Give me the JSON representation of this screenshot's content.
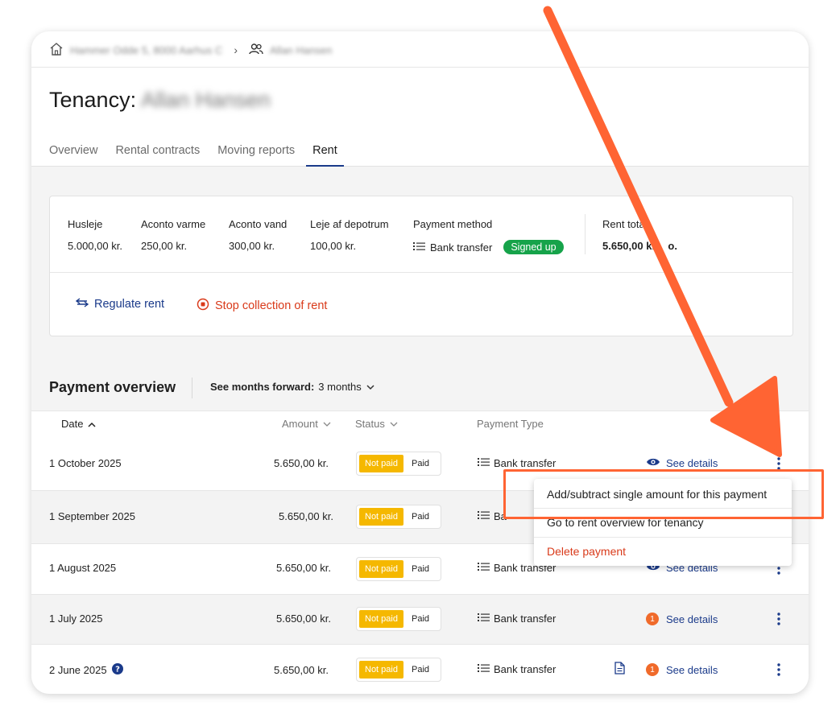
{
  "breadcrumb": {
    "property": "Hammer Odde 5, 8000 Aarhus C",
    "tenant": "Allan Hansen"
  },
  "page": {
    "title_prefix": "Tenancy:",
    "tenant_name": "Allan Hansen"
  },
  "tabs": [
    {
      "label": "Overview",
      "active": false
    },
    {
      "label": "Rental contracts",
      "active": false
    },
    {
      "label": "Moving reports",
      "active": false
    },
    {
      "label": "Rent",
      "active": true
    }
  ],
  "rent": {
    "items": [
      {
        "label": "Husleje",
        "value": "5.000,00 kr."
      },
      {
        "label": "Aconto varme",
        "value": "250,00 kr."
      },
      {
        "label": "Aconto vand",
        "value": "300,00 kr."
      },
      {
        "label": "Leje af depotrum",
        "value": "100,00 kr."
      }
    ],
    "payment_method_label": "Payment method",
    "payment_method_value": "Bank transfer",
    "signed_up_badge": "Signed up",
    "total_label": "Rent total",
    "total_value": "5.650,00 kr. ",
    "total_suffix": "o.",
    "regulate_label": "Regulate rent",
    "stop_label": "Stop collection of rent"
  },
  "payment_overview": {
    "title": "Payment overview",
    "months_label": "See months forward:",
    "months_value": "3 months",
    "columns": {
      "date": "Date",
      "amount": "Amount",
      "status": "Status",
      "payment_type": "Payment Type"
    },
    "rows": [
      {
        "date": "1 October 2025",
        "amount": "5.650,00 kr.",
        "status_not_paid": "Not paid",
        "status_paid": "Paid",
        "payment_type": "Bank transfer",
        "details": "See details"
      },
      {
        "date": "1 September 2025",
        "amount": "5.650,00 kr.",
        "status_not_paid": "Not paid",
        "status_paid": "Paid",
        "payment_type": "Ba",
        "details": ""
      },
      {
        "date": "1 August 2025",
        "amount": "5.650,00 kr.",
        "status_not_paid": "Not paid",
        "status_paid": "Paid",
        "payment_type": "Bank transfer",
        "details": "See details"
      },
      {
        "date": "1 July 2025",
        "amount": "5.650,00 kr.",
        "status_not_paid": "Not paid",
        "status_paid": "Paid",
        "payment_type": "Bank transfer",
        "details": "See details",
        "count": "1"
      },
      {
        "date": "2 June 2025",
        "amount": "5.650,00 kr.",
        "status_not_paid": "Not paid",
        "status_paid": "Paid",
        "payment_type": "Bank transfer",
        "details": "See details",
        "count": "1"
      }
    ]
  },
  "context_menu": {
    "items": [
      {
        "label": "Add/subtract single amount for this payment"
      },
      {
        "label": "Go to rent overview for tenancy"
      },
      {
        "label": "Delete payment"
      }
    ]
  },
  "colors": {
    "accent_blue": "#1a3a8a",
    "danger": "#d93a1a",
    "warning": "#f5b800",
    "success": "#16a34a",
    "annotation": "#ff6433"
  }
}
